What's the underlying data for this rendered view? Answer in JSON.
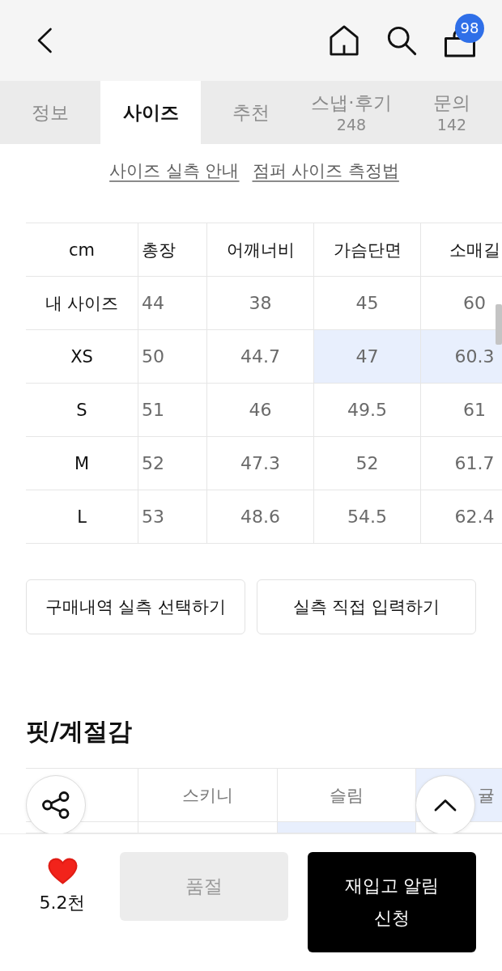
{
  "header": {
    "cart_count": "98"
  },
  "tabs": [
    {
      "label": "정보",
      "selected": false
    },
    {
      "label": "사이즈",
      "selected": true
    },
    {
      "label": "추천",
      "selected": false
    },
    {
      "label": "스냅·후기",
      "count": "248",
      "selected": false
    },
    {
      "label": "문의",
      "count": "142",
      "selected": false
    }
  ],
  "guide_links": [
    "사이즈 실측 안내",
    "점퍼 사이즈 측정법"
  ],
  "size_table": {
    "corner": "cm",
    "columns": [
      "총장",
      "어깨너비",
      "가슴단면",
      "소매길"
    ],
    "rows": [
      {
        "label": "내 사이즈",
        "cells": [
          {
            "value": "44",
            "highlighted": false
          },
          {
            "value": "38",
            "highlighted": false
          },
          {
            "value": "45",
            "highlighted": false
          },
          {
            "value": "60",
            "highlighted": false
          }
        ]
      },
      {
        "label": "XS",
        "cells": [
          {
            "value": "50",
            "highlighted": false
          },
          {
            "value": "44.7",
            "highlighted": false
          },
          {
            "value": "47",
            "highlighted": true
          },
          {
            "value": "60.3",
            "highlighted": true
          }
        ]
      },
      {
        "label": "S",
        "cells": [
          {
            "value": "51",
            "highlighted": false
          },
          {
            "value": "46",
            "highlighted": false
          },
          {
            "value": "49.5",
            "highlighted": false
          },
          {
            "value": "61",
            "highlighted": false
          }
        ]
      },
      {
        "label": "M",
        "cells": [
          {
            "value": "52",
            "highlighted": false
          },
          {
            "value": "47.3",
            "highlighted": false
          },
          {
            "value": "52",
            "highlighted": false
          },
          {
            "value": "61.7",
            "highlighted": false
          }
        ]
      },
      {
        "label": "L",
        "cells": [
          {
            "value": "53",
            "highlighted": false
          },
          {
            "value": "48.6",
            "highlighted": false
          },
          {
            "value": "54.5",
            "highlighted": false
          },
          {
            "value": "62.4",
            "highlighted": false
          }
        ]
      }
    ]
  },
  "actions": [
    "구매내역 실측 선택하기",
    "실측 직접 입력하기"
  ],
  "fit_section": {
    "title": "핏/계절감",
    "rows": [
      {
        "cells": [
          {
            "highlighted": false
          },
          {
            "text": "스키니",
            "highlighted": false
          },
          {
            "text": "슬림",
            "highlighted": false
          },
          {
            "text": "귤",
            "highlighted": true
          }
        ]
      },
      {
        "cells": [
          {
            "highlighted": false
          },
          {
            "highlighted": false
          },
          {
            "highlighted": true
          },
          {
            "highlighted": false
          }
        ]
      }
    ]
  },
  "bottom_bar": {
    "like": {
      "liked": true,
      "count": "5.2천"
    },
    "sold_out_button": {
      "label": "품절",
      "disabled": true
    },
    "restock_button": {
      "label": "재입고 알림 신청"
    }
  }
}
